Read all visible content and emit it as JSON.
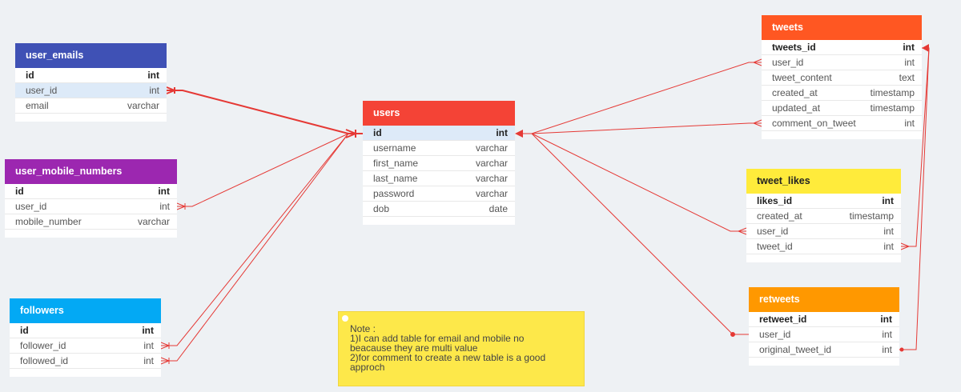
{
  "colors": {
    "user_emails": "#3f51b5",
    "user_mobile_numbers": "#9c27b0",
    "followers": "#03a9f4",
    "users": "#f44336",
    "tweets": "#ff5722",
    "tweet_likes": "#ffeb3b",
    "retweets": "#ff9800",
    "relation_line": "#e53935",
    "note_bg": "#fde84a"
  },
  "tables": {
    "user_emails": {
      "title": "user_emails",
      "rows": [
        {
          "name": "id",
          "type": "int"
        },
        {
          "name": "user_id",
          "type": "int"
        },
        {
          "name": "email",
          "type": "varchar"
        }
      ]
    },
    "user_mobile_numbers": {
      "title": "user_mobile_numbers",
      "rows": [
        {
          "name": "id",
          "type": "int"
        },
        {
          "name": "user_id",
          "type": "int"
        },
        {
          "name": "mobile_number",
          "type": "varchar"
        }
      ]
    },
    "followers": {
      "title": "followers",
      "rows": [
        {
          "name": "id",
          "type": "int"
        },
        {
          "name": "follower_id",
          "type": "int"
        },
        {
          "name": "followed_id",
          "type": "int"
        }
      ]
    },
    "users": {
      "title": "users",
      "rows": [
        {
          "name": "id",
          "type": "int"
        },
        {
          "name": "username",
          "type": "varchar"
        },
        {
          "name": "first_name",
          "type": "varchar"
        },
        {
          "name": "last_name",
          "type": "varchar"
        },
        {
          "name": "password",
          "type": "varchar"
        },
        {
          "name": "dob",
          "type": "date"
        }
      ]
    },
    "tweets": {
      "title": "tweets",
      "rows": [
        {
          "name": "tweets_id",
          "type": "int"
        },
        {
          "name": "user_id",
          "type": "int"
        },
        {
          "name": "tweet_content",
          "type": "text"
        },
        {
          "name": "created_at",
          "type": "timestamp"
        },
        {
          "name": "updated_at",
          "type": "timestamp"
        },
        {
          "name": "comment_on_tweet",
          "type": "int"
        }
      ]
    },
    "tweet_likes": {
      "title": "tweet_likes",
      "rows": [
        {
          "name": "likes_id",
          "type": "int"
        },
        {
          "name": "created_at",
          "type": "timestamp"
        },
        {
          "name": "user_id",
          "type": "int"
        },
        {
          "name": "tweet_id",
          "type": "int"
        }
      ]
    },
    "retweets": {
      "title": "retweets",
      "rows": [
        {
          "name": "retweet_id",
          "type": "int"
        },
        {
          "name": "user_id",
          "type": "int"
        },
        {
          "name": "original_tweet_id",
          "type": "int"
        }
      ]
    }
  },
  "note": {
    "lines": [
      "Note :",
      "1)I can add table for email and mobile no",
      "beacause they are multi value",
      "2)for comment to create a new table is a good",
      "approch"
    ]
  }
}
